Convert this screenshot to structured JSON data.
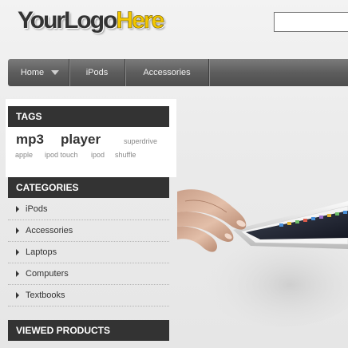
{
  "logo": {
    "part1": "YourLogo",
    "part2": "Here"
  },
  "search": {
    "value": "",
    "placeholder": ""
  },
  "nav": {
    "items": [
      "Home",
      "iPods",
      "Accessories"
    ]
  },
  "tags": {
    "title": "TAGS",
    "items": [
      "mp3",
      "player",
      "superdrive",
      "apple",
      "ipod touch",
      "ipod",
      "shuffle"
    ]
  },
  "categories": {
    "title": "CATEGORIES",
    "items": [
      "iPods",
      "Accessories",
      "Laptops",
      "Computers",
      "Textbooks"
    ]
  },
  "viewed": {
    "title": "VIEWED PRODUCTS"
  }
}
